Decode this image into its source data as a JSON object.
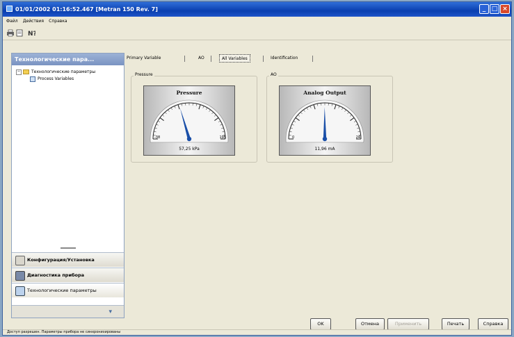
{
  "window": {
    "title": "01/01/2002 01:16:52.467 [Metran 150 Rev. 7]"
  },
  "titlebar_buttons": {
    "minimize": "_",
    "maximize": "□",
    "close": "×"
  },
  "menu": [
    "Файл",
    "Действия",
    "Справка"
  ],
  "toolbar": {
    "icons": [
      "print-icon",
      "preview-icon",
      "help-icon"
    ]
  },
  "nav": {
    "header": "Технологические пара...",
    "tree": {
      "root": "Технологические параметры",
      "child": "Process Variables"
    },
    "buttons": [
      {
        "label": "Конфигурация/Установка",
        "icon": "config-icon"
      },
      {
        "label": "Диагностика прибора",
        "icon": "diagnostics-icon"
      },
      {
        "label": "Технологические параметры",
        "icon": "process-icon"
      }
    ]
  },
  "tabs": [
    "Primary Variable",
    "AO",
    "All Variables",
    "Identification"
  ],
  "selected_tab": "All Variables",
  "gauges": [
    {
      "group": "Pressure",
      "title": "Pressure",
      "value_text": "57,25 kPa",
      "min_label": "-38",
      "max_label": "195",
      "value": 57.25
    },
    {
      "group": "AO",
      "title": "Analog Output",
      "value_text": "11,96 mA",
      "min_label": "0",
      "max_label": "24",
      "value": 11.96
    }
  ],
  "footer": {
    "ok": "OK",
    "cancel": "Отмена",
    "apply": "Применить",
    "print": "Печать",
    "help": "Справка"
  },
  "status": "Доступ разрешен. Параметры прибора не синхронизированы",
  "colors": {
    "title_bar": "#0a3fb0",
    "needle": "#1a4fa8",
    "panel_bg": "#ece9d8"
  }
}
